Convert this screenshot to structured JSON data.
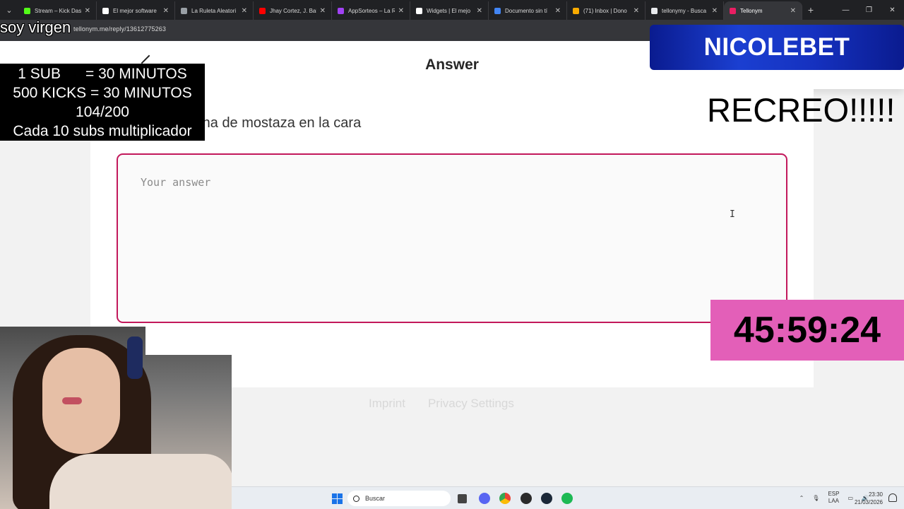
{
  "browser": {
    "tabs": [
      {
        "label": "Stream – Kick Das",
        "fav_color": "#53fc18"
      },
      {
        "label": "El mejor software",
        "fav_color": "#ffffff"
      },
      {
        "label": "La Ruleta Aleatori",
        "fav_color": "#9aa0a6"
      },
      {
        "label": "Jhay Cortez, J. Bal",
        "fav_color": "#ff0000"
      },
      {
        "label": "AppSorteos – La R",
        "fav_color": "#a142f4"
      },
      {
        "label": "Widgets | El mejo",
        "fav_color": "#ffffff"
      },
      {
        "label": "Documento sin tí",
        "fav_color": "#4285f4"
      },
      {
        "label": "(71) Inbox | Dono",
        "fav_color": "#f9ab00"
      },
      {
        "label": "tellonymy - Busca",
        "fav_color": "#e8eaed"
      },
      {
        "label": "Tellonym",
        "fav_color": "#e91e63"
      }
    ],
    "active_tab_index": 9,
    "new_tab_symbol": "+",
    "url": "tellonym.me/reply/13612775263"
  },
  "page": {
    "header_title": "Answer",
    "question": "nes una mancha de mostaza en la cara",
    "answer_placeholder": "Your answer",
    "footer_links": [
      "Imprint",
      "Privacy Settings"
    ]
  },
  "overlays": {
    "top_left_text": "soy virgen",
    "rules": [
      "1 SUB      = 30 MINUTOS",
      "500 KICKS = 30 MINUTOS",
      "104/200",
      "Cada 10 subs multiplicador"
    ],
    "brand": "NICOLEBET",
    "recreo": "RECREO!!!!!",
    "timer": "45:59:24"
  },
  "taskbar": {
    "search_placeholder": "Buscar",
    "lang_top": "ESP",
    "lang_bottom": "LAA",
    "time": "23:30",
    "date": "21/03/2026"
  },
  "colors": {
    "accent": "#c2185b",
    "timer_bg": "#e35fb8",
    "brand_bg": "#1b3fd1"
  }
}
